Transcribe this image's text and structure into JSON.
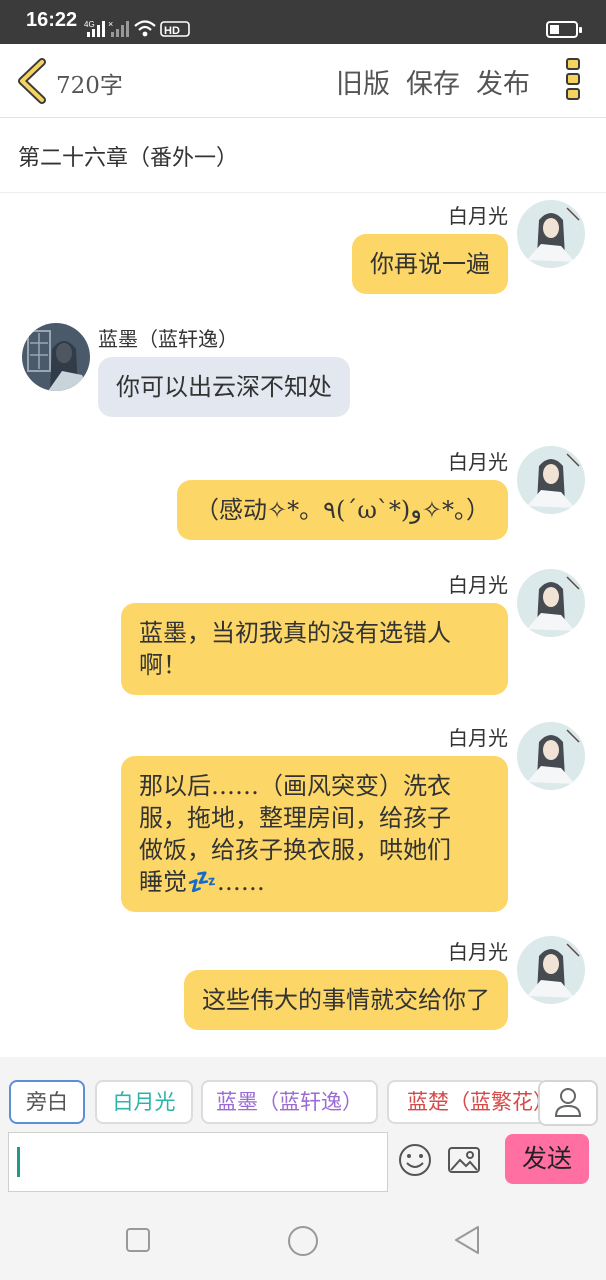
{
  "status": {
    "time": "16:22",
    "network": "4G",
    "hd_label": "HD"
  },
  "toolbar": {
    "word_count": "720字",
    "old_version": "旧版",
    "save": "保存",
    "publish": "发布"
  },
  "chapter": {
    "title": "第二十六章（番外一）"
  },
  "messages": [
    {
      "side": "right",
      "name": "白月光",
      "lines": [
        "你再说一遍"
      ]
    },
    {
      "side": "left",
      "name": "蓝墨（蓝轩逸）",
      "lines": [
        "你可以出云深不知处"
      ]
    },
    {
      "side": "right",
      "name": "白月光",
      "lines": [
        "（感动✧*。٩(ˊωˋ*)و✧*。）"
      ]
    },
    {
      "side": "right",
      "name": "白月光",
      "lines": [
        "蓝墨，当初我真的没有选错人",
        "啊！"
      ]
    },
    {
      "side": "right",
      "name": "白月光",
      "lines": [
        "那以后……（画风突变）洗衣",
        "服，拖地，整理房间，给孩子",
        "做饭，给孩子换衣服，哄她们",
        "睡觉💤……"
      ]
    },
    {
      "side": "right",
      "name": "白月光",
      "lines": [
        "这些伟大的事情就交给你了"
      ]
    }
  ],
  "characters": [
    {
      "label": "旁白",
      "color": "#555555",
      "selected": true
    },
    {
      "label": "白月光",
      "color": "#2bb5a8",
      "selected": false
    },
    {
      "label": "蓝墨（蓝轩逸）",
      "color": "#9b6bd6",
      "selected": false
    },
    {
      "label": "蓝楚（蓝繁花）",
      "color": "#d64a4a",
      "selected": false
    }
  ],
  "input": {
    "value": "",
    "send_label": "发送"
  },
  "colors": {
    "accent": "#f6d35e",
    "bubble_right": "#fcd767",
    "bubble_left": "#e3e8f0",
    "send": "#ff6fa2"
  }
}
